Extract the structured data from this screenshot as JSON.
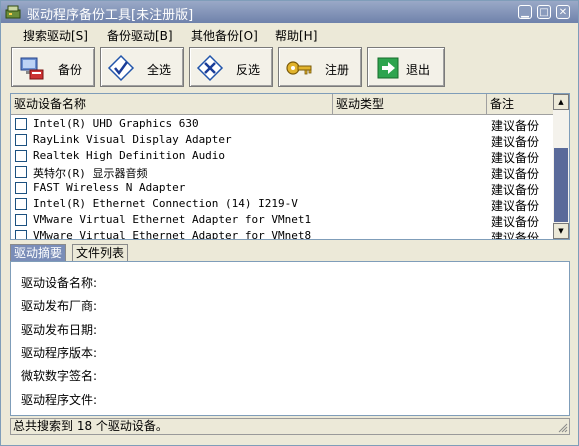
{
  "window": {
    "title": "驱动程序备份工具[未注册版]"
  },
  "menu": [
    {
      "label": "搜索驱动[S]"
    },
    {
      "label": "备份驱动[B]"
    },
    {
      "label": "其他备份[O]"
    },
    {
      "label": "帮助[H]"
    }
  ],
  "toolbar": {
    "backup": "备份",
    "select_all": "全选",
    "invert": "反选",
    "register": "注册",
    "exit": "退出"
  },
  "table": {
    "headers": [
      "驱动设备名称",
      "驱动类型",
      "备注"
    ],
    "rows": [
      {
        "name": "Intel(R) UHD Graphics 630",
        "note": "建议备份"
      },
      {
        "name": "RayLink Visual Display Adapter",
        "note": "建议备份"
      },
      {
        "name": "Realtek High Definition Audio",
        "note": "建议备份"
      },
      {
        "name": "英特尔(R) 显示器音频",
        "note": "建议备份"
      },
      {
        "name": "FAST Wireless N Adapter",
        "note": "建议备份"
      },
      {
        "name": "Intel(R) Ethernet Connection (14) I219-V",
        "note": "建议备份"
      },
      {
        "name": "VMware Virtual Ethernet Adapter for VMnet1",
        "note": "建议备份"
      },
      {
        "name": "VMware Virtual Ethernet Adapter for VMnet8",
        "note": "建议备份"
      }
    ]
  },
  "tabs": [
    "驱动摘要",
    "文件列表"
  ],
  "details": {
    "device_name": "驱动设备名称:",
    "vendor": "驱动发布厂商:",
    "date": "驱动发布日期:",
    "version": "驱动程序版本:",
    "signature": "微软数字签名:",
    "files": "驱动程序文件:"
  },
  "status": "总共搜索到 18 个驱动设备。",
  "colors": {
    "titlebar": "#7f90b5",
    "face": "#ece9d8",
    "scroll_thumb": "#5a6a9a",
    "active_tab": "#7a8db8"
  }
}
